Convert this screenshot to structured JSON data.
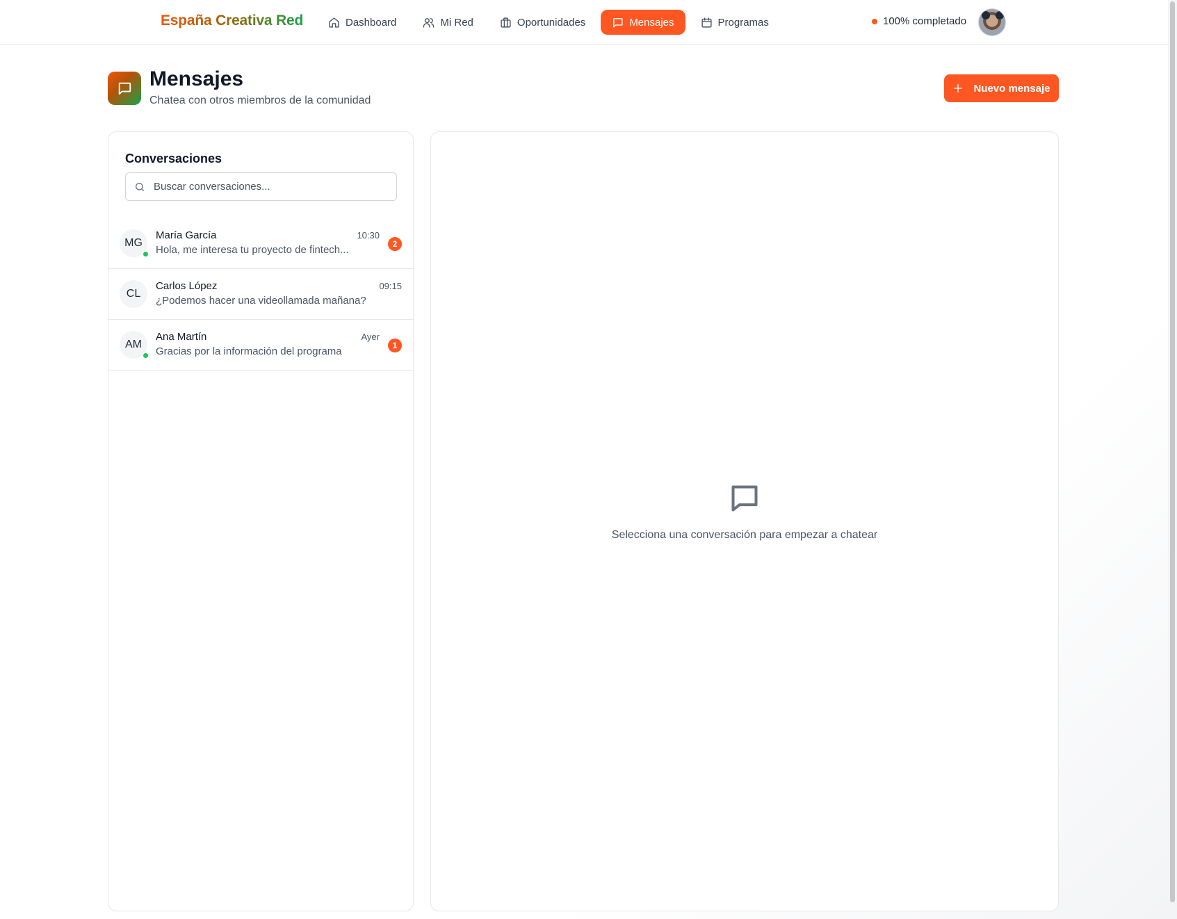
{
  "brand": "España Creativa Red",
  "nav": {
    "items": [
      {
        "label": "Dashboard",
        "icon": "home-icon"
      },
      {
        "label": "Mi Red",
        "icon": "users-icon"
      },
      {
        "label": "Oportunidades",
        "icon": "briefcase-icon"
      },
      {
        "label": "Mensajes",
        "icon": "message-icon",
        "active": true
      },
      {
        "label": "Programas",
        "icon": "calendar-icon"
      }
    ]
  },
  "profile": {
    "status_text": "100% completado",
    "status_color": "#ff5722"
  },
  "header": {
    "title": "Mensajes",
    "subtitle": "Chatea con otros miembros de la comunidad",
    "new_button_label": "Nuevo mensaje"
  },
  "conversations": {
    "title": "Conversaciones",
    "search_placeholder": "Buscar conversaciones...",
    "items": [
      {
        "initials": "MG",
        "name": "María García",
        "time": "10:30",
        "preview": "Hola, me interesa tu proyecto de fintech...",
        "unread": "2",
        "online": true
      },
      {
        "initials": "CL",
        "name": "Carlos López",
        "time": "09:15",
        "preview": "¿Podemos hacer una videollamada mañana?",
        "unread": null,
        "online": false
      },
      {
        "initials": "AM",
        "name": "Ana Martín",
        "time": "Ayer",
        "preview": "Gracias por la información del programa",
        "unread": "1",
        "online": true
      }
    ]
  },
  "chat": {
    "empty_text": "Selecciona una conversación para empezar a chatear"
  },
  "colors": {
    "accent": "#ff5722",
    "online": "#22c55e"
  }
}
